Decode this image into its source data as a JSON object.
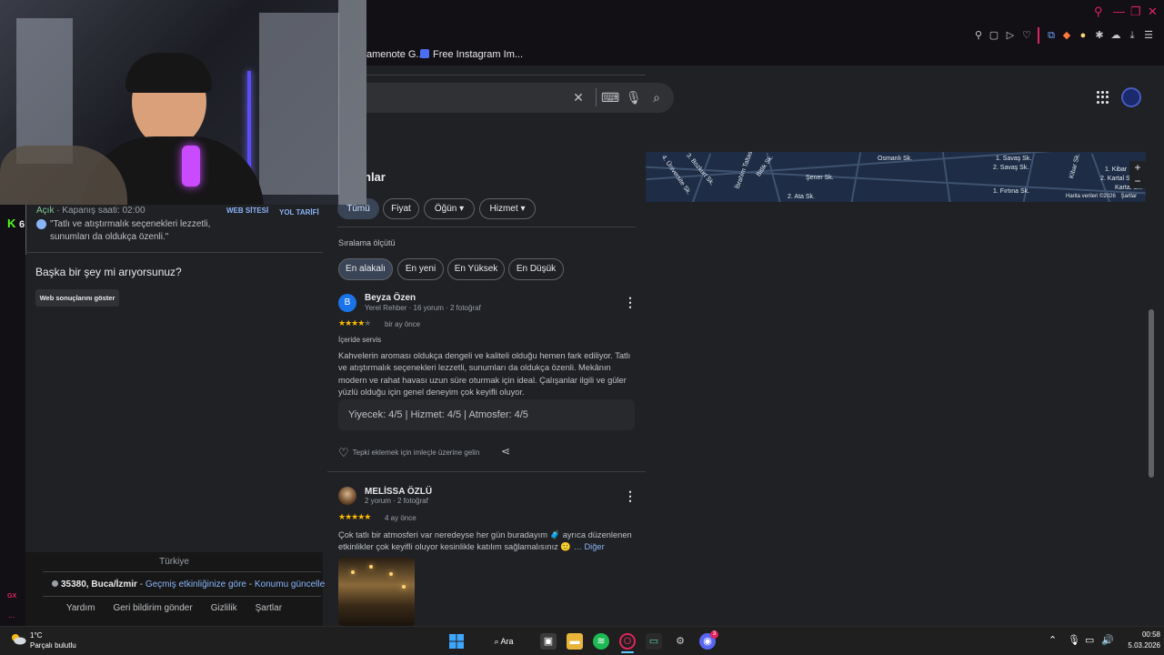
{
  "window": {
    "minimize": "—",
    "restore": "❐",
    "close": "✕"
  },
  "bookmarks": [
    {
      "label": "amenote G..."
    },
    {
      "label": "Free Instagram Im..."
    }
  ],
  "search": {
    "clear_icon": "close-icon",
    "keyboard_icon": "keyboard-icon",
    "mic_icon": "mic-icon",
    "search_icon": "search-icon"
  },
  "left_panel": {
    "status_open": "Açık",
    "closing_time": "· Kapanış saati: 02:00",
    "website_label": "WEB SİTESİ",
    "directions_label": "YOL TARİFİ",
    "quote": "\"Tatlı ve atıştırmalık seçenekleri lezzetli, sunumları da oldukça özenli.\"",
    "more_question": "Başka bir şey mi arıyorsunuz?",
    "web_results_button": "Web sonuçlarını göster",
    "footer": {
      "country": "Türkiye",
      "postal": "35380, Buca/İzmir",
      "separator1": " - ",
      "history_link": "Geçmiş etkinliğinize göre",
      "separator2": " - ",
      "update_link": "Konumu güncelle",
      "links": [
        "Yardım",
        "Geri bildirim gönder",
        "Gizlilik",
        "Şartlar"
      ]
    }
  },
  "reviews": {
    "title": "nlar",
    "filters": [
      "Tümü",
      "Fiyat",
      "Öğün",
      "Hizmet"
    ],
    "sort_label": "Sıralama ölçütü",
    "sort_options": [
      "En alakalı",
      "En yeni",
      "En Yüksek",
      "En Düşük"
    ],
    "items": [
      {
        "initial": "B",
        "name": "Beyza Özen",
        "meta": "Yerel Rehber · 16 yorum · 2 fotoğraf",
        "rating": 4,
        "time": "bir ay önce",
        "tag": "İçeride servis",
        "text": "Kahvelerin aroması oldukça dengeli ve kaliteli olduğu hemen fark ediliyor. Tatlı ve atıştırmalık seçenekleri lezzetli, sunumları da oldukça özenli. Mekânın modern ve rahat havası uzun süre oturmak için ideal. Çalışanlar ilgili ve güler yüzlü olduğu için genel deneyim çok keyifli oluyor.",
        "sub_ratings": "Yiyecek: 4/5  |  Hizmet: 4/5  |  Atmosfer: 4/5",
        "react_prompt": "Tepki eklemek için imleçle üzerine gelin"
      },
      {
        "name": "MELİSSA ÖZLÜ",
        "meta": "2 yorum · 2 fotoğraf",
        "rating": 5,
        "time": "4 ay önce",
        "text": "Çok tatlı bir atmosferi var neredeyse her gün buradayım 🧳 ayrıca düzenlenen etkinlikler çok keyifli oluyor kesinlikle katılım sağlamalısınız 🙂",
        "more_link": "… Diğer"
      }
    ]
  },
  "map": {
    "labels": [
      "Osmanlı Sk.",
      "İbrahim Taltası Sk.",
      "Şener Sk.",
      "1. Savaş Sk.",
      "2. Savaş Sk.",
      "Kibar Sk.",
      "1. Kibar",
      "2. Kartal Sk.",
      "Kartal Sk.",
      "1. Fırtına Sk.",
      "2. Ata Sk.",
      "3. Bozkurt Sk.",
      "4. Üniversite Sk.",
      "Bitlik Sk."
    ],
    "credits": "Harita verileri ©2026",
    "terms": "Şartlar"
  },
  "sidebar": {
    "kick_count": "6",
    "gx_label": "GX",
    "more": "..."
  },
  "taskbar": {
    "temperature": "1°C",
    "weather": "Parçalı bulutlu",
    "search_label": "Ara",
    "time": "00:58",
    "date": "5.03.2026",
    "discord_badge": "3"
  },
  "colors": {
    "accent_blue": "#8ab4f8",
    "open_green": "#81c995",
    "star": "#fbbc04",
    "gx_red": "#e0245e"
  }
}
